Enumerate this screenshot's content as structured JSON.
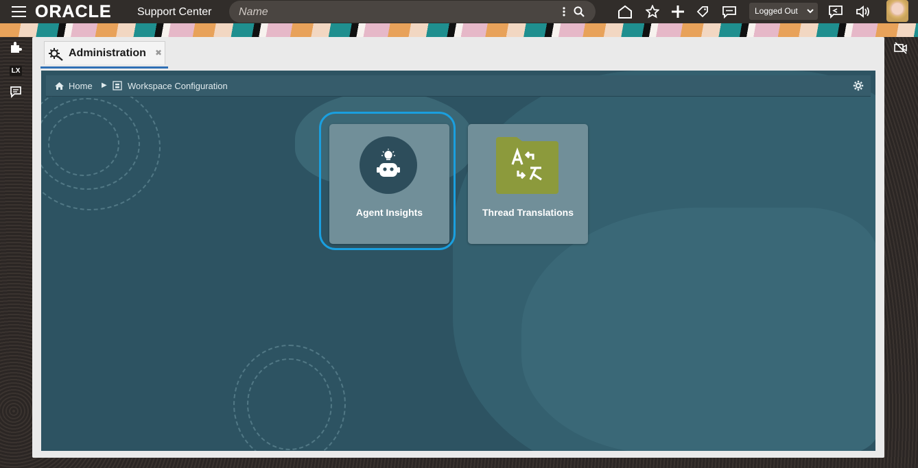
{
  "topbar": {
    "brand": "ORACLE",
    "app_name": "Support Center",
    "search_placeholder": "Name",
    "status": "Logged Out"
  },
  "tab": {
    "label": "Administration"
  },
  "breadcrumb": {
    "home": "Home",
    "current": "Workspace Configuration"
  },
  "rail": {
    "lx": "LX"
  },
  "cards": [
    {
      "title": "Agent Insights",
      "icon": "robot-icon",
      "selected": true
    },
    {
      "title": "Thread Translations",
      "icon": "translate-icon",
      "selected": false
    }
  ],
  "colors": {
    "accent": "#1a9fdf",
    "workspace_bg": "#2d5362",
    "card_bg": "#718f99",
    "folder": "#8c9a3c"
  }
}
